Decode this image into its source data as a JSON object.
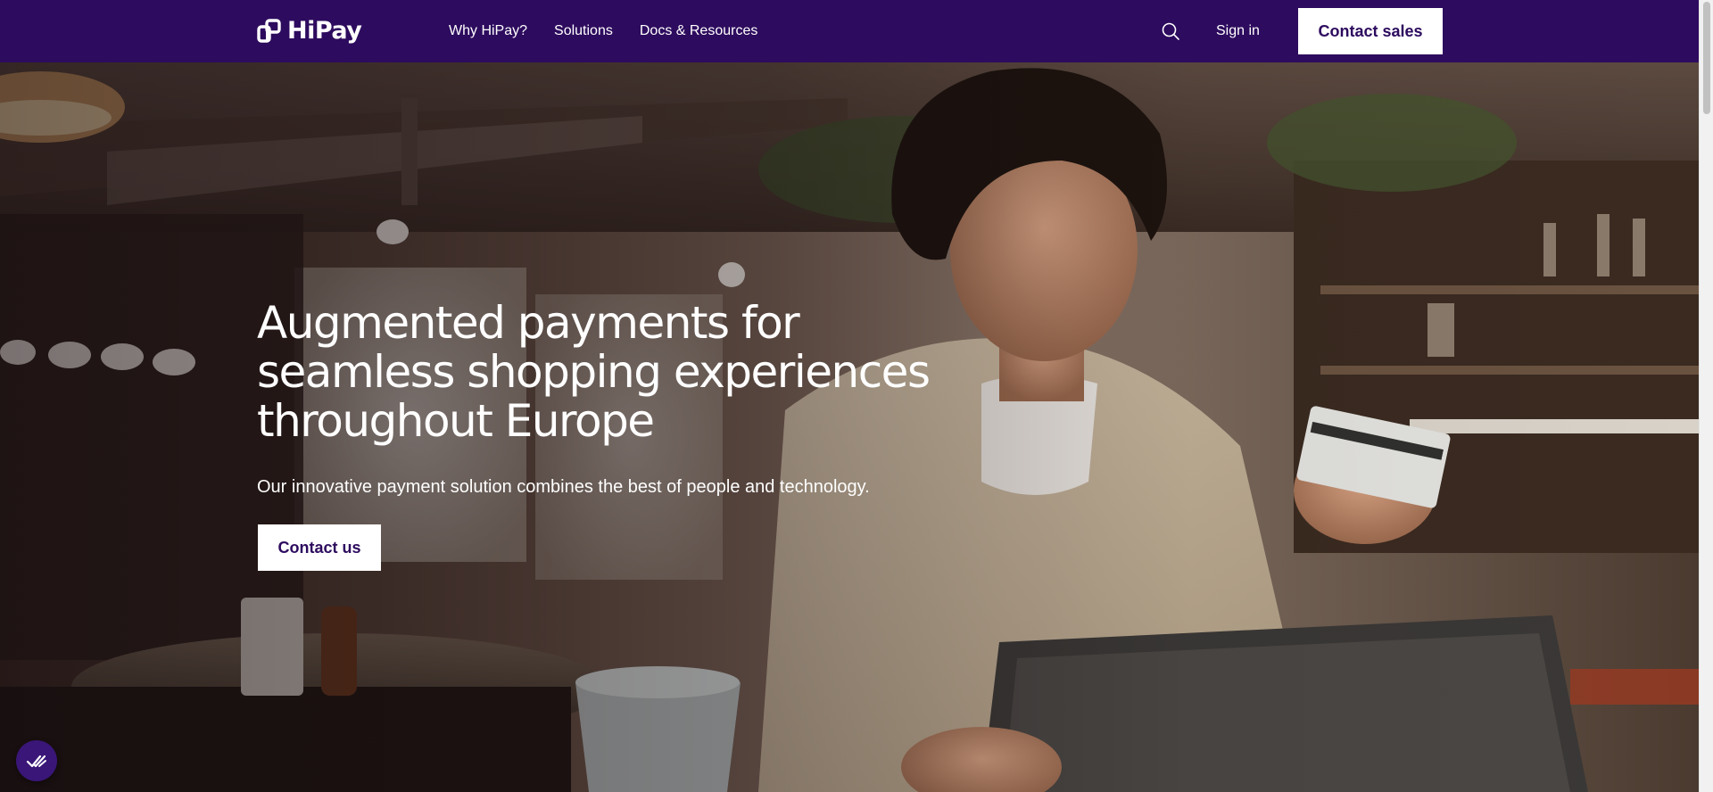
{
  "header": {
    "logo_text": "HiPay",
    "nav": [
      {
        "label": "Why HiPay?"
      },
      {
        "label": "Solutions"
      },
      {
        "label": "Docs & Resources"
      }
    ],
    "search_icon": "search-icon",
    "sign_in_label": "Sign in",
    "contact_sales_label": "Contact sales"
  },
  "hero": {
    "title": "Augmented payments for seamless shopping experiences throughout Europe",
    "subtitle": "Our innovative payment solution combines the best of people and technology.",
    "cta_label": "Contact us",
    "background": "photo-man-in-cafe-paying-with-card-on-tablet"
  },
  "widget": {
    "icon": "double-check-icon"
  },
  "colors": {
    "brand_purple": "#2d0b5e",
    "widget_purple": "#3a1678",
    "white": "#ffffff"
  }
}
